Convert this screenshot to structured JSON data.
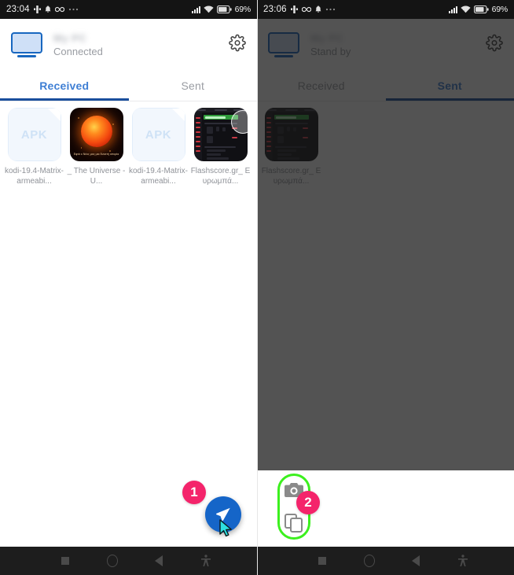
{
  "screens": [
    {
      "id": "left",
      "status_bar": {
        "clock": "23:04",
        "icons": [
          "vibrate-icon",
          "bell-icon",
          "infinity-icon",
          "more-dots-icon"
        ],
        "signal_icon": "signal-bars-icon",
        "wifi_icon": "wifi-icon",
        "battery_icon": "battery-icon",
        "battery_text": "69%"
      },
      "header": {
        "device_icon": "monitor-icon",
        "device_name": "My PC",
        "status": "Connected",
        "settings_icon": "gear-icon"
      },
      "tabs": [
        {
          "label": "Received",
          "active": true
        },
        {
          "label": "Sent",
          "active": false
        }
      ],
      "files": [
        {
          "type": "apk",
          "thumb_label": "APK",
          "name": "kodi-19.4-Matrix-armeabi..."
        },
        {
          "type": "image",
          "thumb_label": "",
          "name": "_ The Universe - U...",
          "poster_text": "Εφτά ο Νέος μας μια δυνατή ιστορία"
        },
        {
          "type": "apk",
          "thumb_label": "APK",
          "name": "kodi-19.4-Matrix-armeabi..."
        },
        {
          "type": "screenshot",
          "thumb_label": "",
          "name": "Flashscore.gr_ Ευρωμπά..."
        }
      ],
      "progress_ring": {
        "visible": true,
        "label": "transfer-progress-ring"
      },
      "fab": {
        "icon": "send-plane-icon",
        "color": "#1565c8"
      },
      "annotation": {
        "number": "1",
        "color": "#f4246b"
      },
      "cursor": {
        "visible": true,
        "color": "#2de0e0"
      },
      "dimmed": false,
      "nav_bar": [
        "recents-square-icon",
        "home-circle-icon",
        "back-triangle-icon",
        "accessibility-icon"
      ]
    },
    {
      "id": "right",
      "status_bar": {
        "clock": "23:06",
        "icons": [
          "vibrate-icon",
          "infinity-icon",
          "bell-icon",
          "more-dots-icon"
        ],
        "signal_icon": "signal-bars-icon",
        "wifi_icon": "wifi-icon",
        "battery_icon": "battery-icon",
        "battery_text": "69%"
      },
      "header": {
        "device_icon": "monitor-icon",
        "device_name": "My PC",
        "status": "Stand by",
        "settings_icon": "gear-icon"
      },
      "tabs": [
        {
          "label": "Received",
          "active": false
        },
        {
          "label": "Sent",
          "active": true
        }
      ],
      "files": [
        {
          "type": "screenshot",
          "thumb_label": "",
          "name": "Flashscore.gr_ Ευρωμπά..."
        }
      ],
      "progress_ring": {
        "visible": true,
        "label": "transfer-progress-ring"
      },
      "toolbar": {
        "highlight_color": "#3cf01e",
        "items": [
          "camera-screenshot-icon",
          "copy-duplicate-icon"
        ]
      },
      "annotation": {
        "number": "2",
        "color": "#f4246b"
      },
      "cursor": {
        "visible": false
      },
      "dimmed": true,
      "nav_bar": [
        "recents-square-icon",
        "home-circle-icon",
        "back-triangle-icon",
        "accessibility-icon"
      ]
    }
  ]
}
